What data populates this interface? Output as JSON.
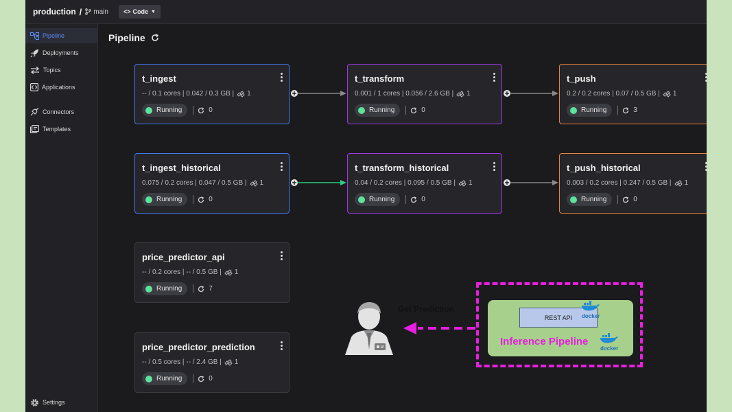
{
  "topbar": {
    "project": "production",
    "separator": "/",
    "branch": "main",
    "code_button": "Code",
    "code_glyph": "<>"
  },
  "sidebar": {
    "items": [
      {
        "label": "Pipeline",
        "icon": "pipeline-icon",
        "active": true
      },
      {
        "label": "Deployments",
        "icon": "rocket-icon"
      },
      {
        "label": "Topics",
        "icon": "arrows-icon"
      },
      {
        "label": "Applications",
        "icon": "code-square-icon"
      },
      {
        "label": "Connectors",
        "icon": "plug-icon"
      },
      {
        "label": "Templates",
        "icon": "templates-icon"
      }
    ],
    "settings": "Settings"
  },
  "page": {
    "title": "Pipeline"
  },
  "cards": [
    {
      "name": "t_ingest",
      "stats": "-- / 0.1 cores | 0.042 / 0.3 GB |",
      "replicas": "1",
      "status": "Running",
      "restarts": "0",
      "color": "#3f7bf0"
    },
    {
      "name": "t_transform",
      "stats": "0.001 / 1 cores | 0.056 / 2.6 GB |",
      "replicas": "1",
      "status": "Running",
      "restarts": "0",
      "color": "#a338e8"
    },
    {
      "name": "t_push",
      "stats": "0.2 / 0.2 cores | 0.07 / 0.5 GB |",
      "replicas": "1",
      "status": "Running",
      "restarts": "3",
      "color": "#e8843b"
    },
    {
      "name": "t_ingest_historical",
      "stats": "0.075 / 0.2 cores | 0.047 / 0.5 GB |",
      "replicas": "1",
      "status": "Running",
      "restarts": "0",
      "color": "#3f7bf0"
    },
    {
      "name": "t_transform_historical",
      "stats": "0.04 / 0.2 cores | 0.095 / 0.5 GB |",
      "replicas": "1",
      "status": "Running",
      "restarts": "0",
      "color": "#a338e8"
    },
    {
      "name": "t_push_historical",
      "stats": "0.003 / 0.2 cores | 0.247 / 0.5 GB |",
      "replicas": "1",
      "status": "Running",
      "restarts": "0",
      "color": "#e8843b"
    },
    {
      "name": "price_predictor_api",
      "stats": "-- / 0.2 cores | -- / 0.5 GB |",
      "replicas": "1",
      "status": "Running",
      "restarts": "7",
      "color": "#3a3a40"
    },
    {
      "name": "price_predictor_prediction",
      "stats": "-- / 0.5 cores | -- / 2.4 GB |",
      "replicas": "1",
      "status": "Running",
      "restarts": "0",
      "color": "#3a3a40"
    }
  ],
  "edges": [
    {
      "from": "t_ingest",
      "to": "t_transform",
      "color": "#8a8a8a"
    },
    {
      "from": "t_transform",
      "to": "t_push",
      "color": "#8a8a8a"
    },
    {
      "from": "t_ingest_historical",
      "to": "t_transform_historical",
      "color": "#2bd07c"
    },
    {
      "from": "t_transform_historical",
      "to": "t_push_historical",
      "color": "#8a8a8a"
    }
  ],
  "overlay": {
    "get_prediction": "Get Prediction",
    "rest_api": "REST API",
    "inference_pipeline": "Inference Pipeline",
    "docker_label": "docker",
    "accent_color": "#e81ee0"
  }
}
